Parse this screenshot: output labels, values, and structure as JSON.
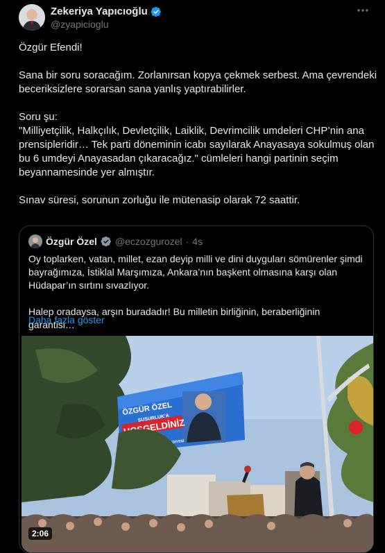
{
  "author": {
    "display_name": "Zekeriya Yapıcıoğlu",
    "handle": "@zyapicioglu"
  },
  "tweet": {
    "text": "Özgür Efendi!\n\nSana bir soru soracağım. Zorlanırsan kopya çekmek serbest. Ama çevrendeki beceriksizlere sorarsan sana yanlış yaptırabilirler.\n\nSoru şu:\n\"Milliyetçilik, Halkçılık, Devletçilik, Laiklik, Devrimcilik umdeleri CHP’nin ana prensipleridir… Tek parti döneminin icabı sayılarak Anayasaya sokulmuş olan bu 6 umdeyi Anayasadan çıkaracağız.\" cümleleri hangi partinin seçim beyannamesinde yer almıştır.\n\nSınav süresi, sorunun zorluğu ile mütenasip olarak 72 saattir."
  },
  "quote": {
    "display_name": "Özgür Özel",
    "handle": "@eczozgurozel",
    "separator": "·",
    "time": "4s",
    "text": "Oy toplarken, vatan, millet, ezan deyip milli ve dini duyguları sömürenler şimdi bayrağımıza, İstiklal Marşımıza, Ankara’nın başkent olmasına karşı olan Hüdapar’ın sırtını sıvazlıyor.\n\nHalep oradaysa, arşın buradadır! Bu milletin birliğinin, beraberliğinin garantisi…",
    "show_more": "Daha fazla göster",
    "video_duration": "2:06",
    "banner": {
      "line1": "ÖZGÜR ÖZEL",
      "line2": "SUSURLUK'A",
      "line3": "HOŞGELDİNİZ",
      "sub": "SUSURLUK BELEDİYESİ"
    }
  },
  "colors": {
    "background": "#000000",
    "text": "#e7e9ea",
    "muted": "#71767b",
    "link": "#1d9bf0",
    "verified": "#1d9bf0",
    "banner_red": "#d9232e"
  },
  "icons": {
    "verified": "verified-badge-icon",
    "more": "more-options-icon"
  }
}
